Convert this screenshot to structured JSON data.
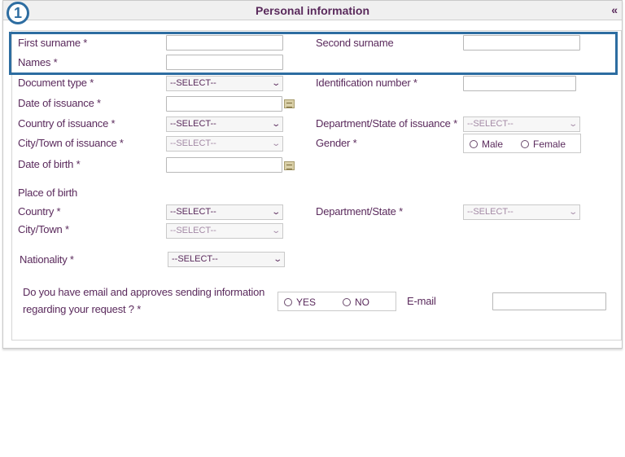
{
  "header": {
    "title": "Personal information",
    "collapse_glyph": "«",
    "step_number": "1"
  },
  "fields": {
    "first_surname_label": "First surname *",
    "second_surname_label": "Second surname",
    "names_label": "Names *",
    "document_type_label": "Document type *",
    "document_type_value": "--SELECT--",
    "identification_number_label": "Identification number *",
    "date_of_issuance_label": "Date of issuance *",
    "country_of_issuance_label": "Country of issuance *",
    "country_of_issuance_value": "--SELECT--",
    "department_of_issuance_label": "Department/State of issuance *",
    "department_of_issuance_value": "--SELECT--",
    "city_of_issuance_label": "City/Town of issuance *",
    "city_of_issuance_value": "--SELECT--",
    "gender_label": "Gender *",
    "gender_male": "Male",
    "gender_female": "Female",
    "date_of_birth_label": "Date of birth *"
  },
  "place_of_birth": {
    "section_label": "Place of birth",
    "country_label": "Country *",
    "country_value": "--SELECT--",
    "department_label": "Department/State *",
    "department_value": "--SELECT--",
    "city_label": "City/Town *",
    "city_value": "--SELECT--"
  },
  "nationality": {
    "label": "Nationality *",
    "value": "--SELECT--"
  },
  "email_consent": {
    "question_line1": "Do you have email and approves sending information",
    "question_line2": "regarding your request ? *",
    "yes_label": "YES",
    "no_label": "NO",
    "email_label": "E-mail"
  },
  "colors": {
    "label_purple": "#5a2a5c",
    "highlight_blue": "#2d6da1"
  }
}
